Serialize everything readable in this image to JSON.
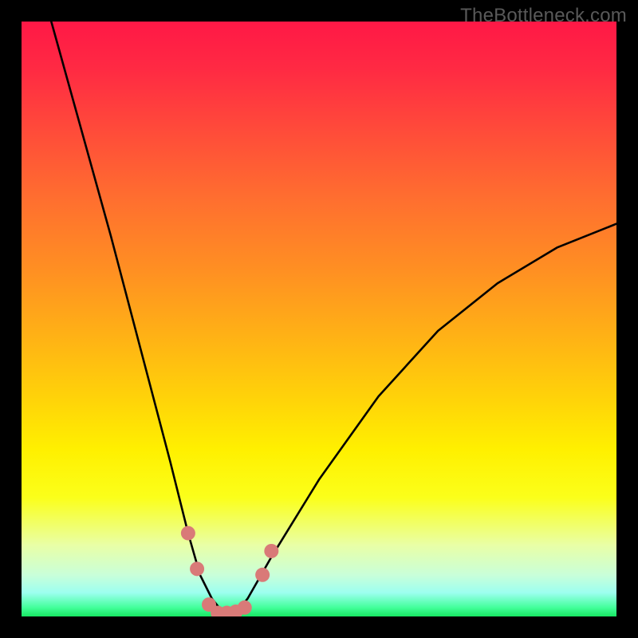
{
  "watermark": "TheBottleneck.com",
  "chart_data": {
    "type": "line",
    "title": "",
    "xlabel": "",
    "ylabel": "",
    "xlim": [
      0,
      100
    ],
    "ylim": [
      0,
      100
    ],
    "grid": false,
    "legend": false,
    "series": [
      {
        "name": "bottleneck-curve",
        "x": [
          5,
          10,
          15,
          20,
          25,
          28,
          30,
          32,
          34,
          36,
          38,
          42,
          50,
          60,
          70,
          80,
          90,
          100
        ],
        "values": [
          100,
          82,
          64,
          45,
          26,
          14,
          7,
          3,
          0.5,
          0.5,
          3,
          10,
          23,
          37,
          48,
          56,
          62,
          66
        ]
      }
    ],
    "markers": [
      {
        "name": "left-upper",
        "x": 28.0,
        "y": 14.0
      },
      {
        "name": "left-lower",
        "x": 29.5,
        "y": 8.0
      },
      {
        "name": "valley-1",
        "x": 31.5,
        "y": 2.0
      },
      {
        "name": "valley-2",
        "x": 33.0,
        "y": 0.6
      },
      {
        "name": "valley-3",
        "x": 34.5,
        "y": 0.6
      },
      {
        "name": "valley-4",
        "x": 36.0,
        "y": 0.8
      },
      {
        "name": "valley-5",
        "x": 37.5,
        "y": 1.5
      },
      {
        "name": "right-lower",
        "x": 40.5,
        "y": 7.0
      },
      {
        "name": "right-upper",
        "x": 42.0,
        "y": 11.0
      }
    ],
    "colors": {
      "curve": "#000000",
      "marker_fill": "#d97a78",
      "marker_stroke": "#a84d4c",
      "gradient_top": "#ff1846",
      "gradient_bottom": "#17e763"
    }
  }
}
